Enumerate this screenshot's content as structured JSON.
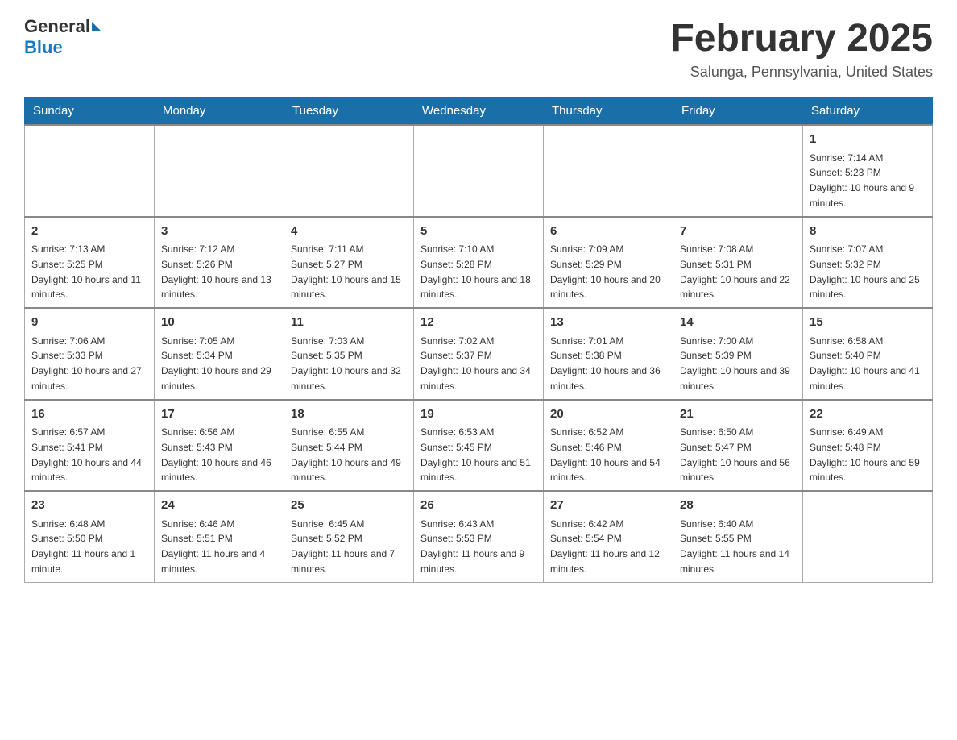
{
  "header": {
    "logo_general": "General",
    "logo_blue": "Blue",
    "month_title": "February 2025",
    "location": "Salunga, Pennsylvania, United States"
  },
  "weekdays": [
    "Sunday",
    "Monday",
    "Tuesday",
    "Wednesday",
    "Thursday",
    "Friday",
    "Saturday"
  ],
  "weeks": [
    [
      {
        "day": "",
        "info": ""
      },
      {
        "day": "",
        "info": ""
      },
      {
        "day": "",
        "info": ""
      },
      {
        "day": "",
        "info": ""
      },
      {
        "day": "",
        "info": ""
      },
      {
        "day": "",
        "info": ""
      },
      {
        "day": "1",
        "info": "Sunrise: 7:14 AM\nSunset: 5:23 PM\nDaylight: 10 hours and 9 minutes."
      }
    ],
    [
      {
        "day": "2",
        "info": "Sunrise: 7:13 AM\nSunset: 5:25 PM\nDaylight: 10 hours and 11 minutes."
      },
      {
        "day": "3",
        "info": "Sunrise: 7:12 AM\nSunset: 5:26 PM\nDaylight: 10 hours and 13 minutes."
      },
      {
        "day": "4",
        "info": "Sunrise: 7:11 AM\nSunset: 5:27 PM\nDaylight: 10 hours and 15 minutes."
      },
      {
        "day": "5",
        "info": "Sunrise: 7:10 AM\nSunset: 5:28 PM\nDaylight: 10 hours and 18 minutes."
      },
      {
        "day": "6",
        "info": "Sunrise: 7:09 AM\nSunset: 5:29 PM\nDaylight: 10 hours and 20 minutes."
      },
      {
        "day": "7",
        "info": "Sunrise: 7:08 AM\nSunset: 5:31 PM\nDaylight: 10 hours and 22 minutes."
      },
      {
        "day": "8",
        "info": "Sunrise: 7:07 AM\nSunset: 5:32 PM\nDaylight: 10 hours and 25 minutes."
      }
    ],
    [
      {
        "day": "9",
        "info": "Sunrise: 7:06 AM\nSunset: 5:33 PM\nDaylight: 10 hours and 27 minutes."
      },
      {
        "day": "10",
        "info": "Sunrise: 7:05 AM\nSunset: 5:34 PM\nDaylight: 10 hours and 29 minutes."
      },
      {
        "day": "11",
        "info": "Sunrise: 7:03 AM\nSunset: 5:35 PM\nDaylight: 10 hours and 32 minutes."
      },
      {
        "day": "12",
        "info": "Sunrise: 7:02 AM\nSunset: 5:37 PM\nDaylight: 10 hours and 34 minutes."
      },
      {
        "day": "13",
        "info": "Sunrise: 7:01 AM\nSunset: 5:38 PM\nDaylight: 10 hours and 36 minutes."
      },
      {
        "day": "14",
        "info": "Sunrise: 7:00 AM\nSunset: 5:39 PM\nDaylight: 10 hours and 39 minutes."
      },
      {
        "day": "15",
        "info": "Sunrise: 6:58 AM\nSunset: 5:40 PM\nDaylight: 10 hours and 41 minutes."
      }
    ],
    [
      {
        "day": "16",
        "info": "Sunrise: 6:57 AM\nSunset: 5:41 PM\nDaylight: 10 hours and 44 minutes."
      },
      {
        "day": "17",
        "info": "Sunrise: 6:56 AM\nSunset: 5:43 PM\nDaylight: 10 hours and 46 minutes."
      },
      {
        "day": "18",
        "info": "Sunrise: 6:55 AM\nSunset: 5:44 PM\nDaylight: 10 hours and 49 minutes."
      },
      {
        "day": "19",
        "info": "Sunrise: 6:53 AM\nSunset: 5:45 PM\nDaylight: 10 hours and 51 minutes."
      },
      {
        "day": "20",
        "info": "Sunrise: 6:52 AM\nSunset: 5:46 PM\nDaylight: 10 hours and 54 minutes."
      },
      {
        "day": "21",
        "info": "Sunrise: 6:50 AM\nSunset: 5:47 PM\nDaylight: 10 hours and 56 minutes."
      },
      {
        "day": "22",
        "info": "Sunrise: 6:49 AM\nSunset: 5:48 PM\nDaylight: 10 hours and 59 minutes."
      }
    ],
    [
      {
        "day": "23",
        "info": "Sunrise: 6:48 AM\nSunset: 5:50 PM\nDaylight: 11 hours and 1 minute."
      },
      {
        "day": "24",
        "info": "Sunrise: 6:46 AM\nSunset: 5:51 PM\nDaylight: 11 hours and 4 minutes."
      },
      {
        "day": "25",
        "info": "Sunrise: 6:45 AM\nSunset: 5:52 PM\nDaylight: 11 hours and 7 minutes."
      },
      {
        "day": "26",
        "info": "Sunrise: 6:43 AM\nSunset: 5:53 PM\nDaylight: 11 hours and 9 minutes."
      },
      {
        "day": "27",
        "info": "Sunrise: 6:42 AM\nSunset: 5:54 PM\nDaylight: 11 hours and 12 minutes."
      },
      {
        "day": "28",
        "info": "Sunrise: 6:40 AM\nSunset: 5:55 PM\nDaylight: 11 hours and 14 minutes."
      },
      {
        "day": "",
        "info": ""
      }
    ]
  ]
}
